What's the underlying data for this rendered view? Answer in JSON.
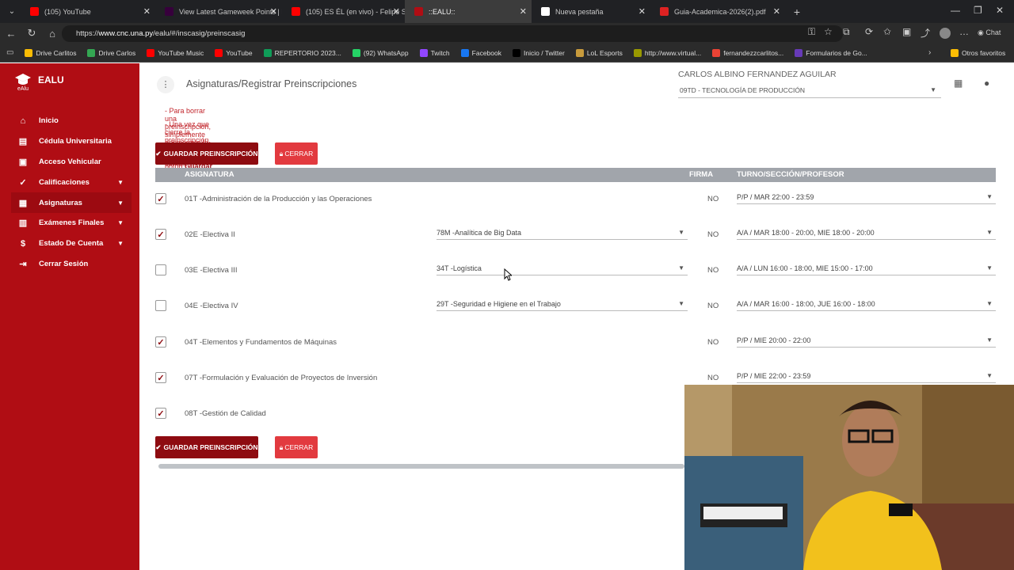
{
  "browser": {
    "tabs": [
      {
        "title": "(105) YouTube",
        "fav_color": "#ff0000"
      },
      {
        "title": "View Latest Gameweek Points | Fa",
        "fav_color": "#37003c"
      },
      {
        "title": "(105) ES ÉL (en vivo) - Felipe S",
        "fav_color": "#ff0000"
      },
      {
        "title": "::EALU::",
        "fav_color": "#b00d14"
      },
      {
        "title": "Nueva pestaña",
        "fav_color": "#ffffff"
      },
      {
        "title": "Guia-Academica-2026(2).pdf",
        "fav_color": "#d22"
      }
    ],
    "url_prefix": "https://",
    "url_domain": "www.cnc.una.py",
    "url_path": "/ealu/#/inscasig/preinscasig",
    "bookmarks": [
      {
        "label": "Drive Carlitos",
        "color": "#fbbc04"
      },
      {
        "label": "Drive Carlos",
        "color": "#34a853"
      },
      {
        "label": "YouTube Music",
        "color": "#ff0000"
      },
      {
        "label": "YouTube",
        "color": "#ff0000"
      },
      {
        "label": "REPERTORIO 2023...",
        "color": "#0f9d58"
      },
      {
        "label": "(92) WhatsApp",
        "color": "#25d366"
      },
      {
        "label": "Twitch",
        "color": "#9146ff"
      },
      {
        "label": "Facebook",
        "color": "#1877f2"
      },
      {
        "label": "Inicio / Twitter",
        "color": "#000000"
      },
      {
        "label": "LoL Esports",
        "color": "#c89b3c"
      },
      {
        "label": "http://www.virtual...",
        "color": "#999900"
      },
      {
        "label": "fernandezzcarlitos...",
        "color": "#ea4335"
      },
      {
        "label": "Formularios de Go...",
        "color": "#673ab7"
      }
    ],
    "other_bookmarks": "Otros favoritos",
    "chat_label": "Chat"
  },
  "app": {
    "brand": "EALU",
    "brand_sub": "eAlu",
    "menu": [
      {
        "label": "Inicio",
        "icon": "home-icon",
        "caret": false
      },
      {
        "label": "Cédula Universitaria",
        "icon": "id-card-icon",
        "caret": false
      },
      {
        "label": "Acceso Vehicular",
        "icon": "car-icon",
        "caret": false
      },
      {
        "label": "Calificaciones",
        "icon": "check-icon",
        "caret": true
      },
      {
        "label": "Asignaturas",
        "icon": "grid-icon",
        "caret": true,
        "active": true
      },
      {
        "label": "Exámenes Finales",
        "icon": "clipboard-icon",
        "caret": true
      },
      {
        "label": "Estado De Cuenta",
        "icon": "dollar-icon",
        "caret": true
      },
      {
        "label": "Cerrar Sesión",
        "icon": "logout-icon",
        "caret": false
      }
    ],
    "page_title": "Asignaturas/Registrar Preinscripciones",
    "user_name": "CARLOS ALBINO FERNANDEZ AGUILAR",
    "career": "09TD - TECNOLOGÍA DE PRODUCCIÓN"
  },
  "notes": {
    "line1_pre": "- Para borrar una preinscripción, simplemente desmarque la asignatura y haga click en el botón ",
    "line1_bold": "Guardar Preinscripción",
    "line2": "- Una vez que cierre la preinscripción, ya no podrá realizar cambios."
  },
  "buttons": {
    "save": "GUARDAR PREINSCRIPCIÓN",
    "close": "CERRAR"
  },
  "table": {
    "headers": {
      "subject": "ASIGNATURA",
      "firma": "FIRMA",
      "turno": "TURNO/SECCIÓN/PROFESOR"
    },
    "rows": [
      {
        "checked": true,
        "subject": "01T -Administración de la Producción y las Operaciones",
        "elective": "",
        "firma": "NO",
        "turno": "P/P / MAR 22:00 - 23:59"
      },
      {
        "checked": true,
        "subject": "02E -Electiva II",
        "elective": "78M -Analítica de Big Data",
        "firma": "NO",
        "turno": "A/A / MAR 18:00 - 20:00, MIE 18:00 - 20:00"
      },
      {
        "checked": false,
        "subject": "03E -Electiva III",
        "elective": "34T -Logística",
        "firma": "NO",
        "turno": "A/A / LUN 16:00 - 18:00, MIE 15:00 - 17:00"
      },
      {
        "checked": false,
        "subject": "04E -Electiva IV",
        "elective": "29T -Seguridad e Higiene en el Trabajo",
        "firma": "NO",
        "turno": "A/A / MAR 16:00 - 18:00, JUE 16:00 - 18:00"
      },
      {
        "checked": true,
        "subject": "04T -Elementos y Fundamentos de Máquinas",
        "elective": "",
        "firma": "NO",
        "turno": "P/P / MIE 20:00 - 22:00"
      },
      {
        "checked": true,
        "subject": "07T -Formulación y Evaluación de Proyectos de Inversión",
        "elective": "",
        "firma": "NO",
        "turno": "P/P / MIE 22:00 - 23:59"
      },
      {
        "checked": true,
        "subject": "08T -Gestión de Calidad",
        "elective": "",
        "firma": "",
        "turno": ""
      }
    ]
  },
  "colors": {
    "sidebar": "#b00d14",
    "save_button": "#8e0b10",
    "close_button": "#e23a3f",
    "header": "#a1a5ab"
  }
}
